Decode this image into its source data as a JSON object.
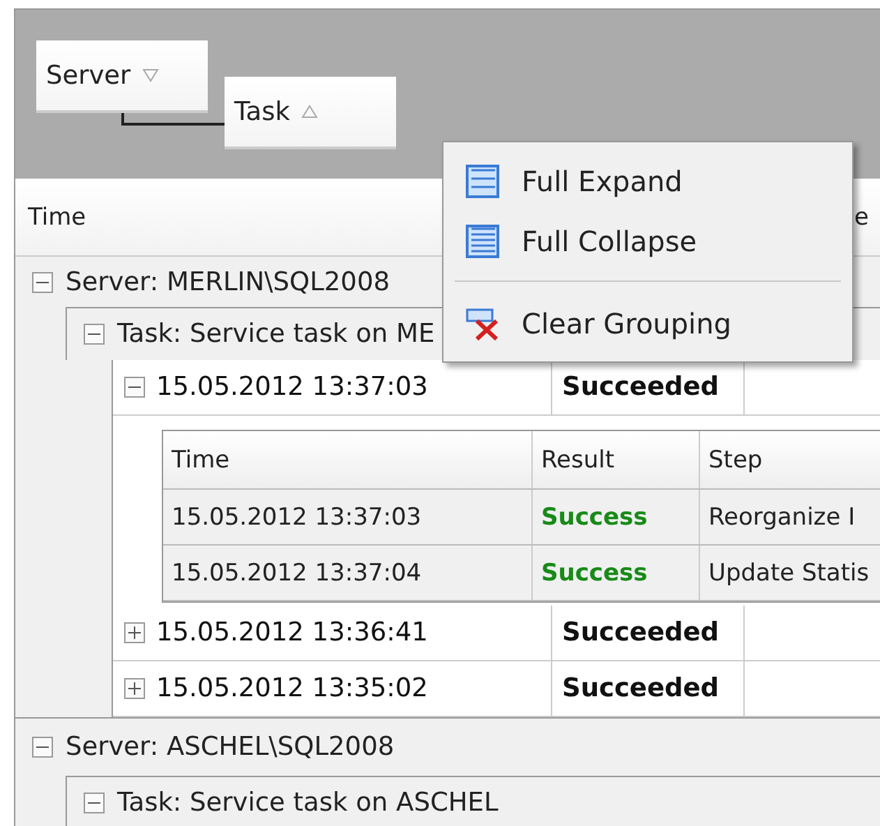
{
  "group_panel": {
    "chips": [
      {
        "label": "Server",
        "descending": true
      },
      {
        "label": "Task",
        "descending": false
      }
    ]
  },
  "columns": [
    {
      "label": "Time"
    },
    {
      "label": "e"
    }
  ],
  "groups": [
    {
      "label": "Server: MERLIN\\SQL2008",
      "expanded": true,
      "children": [
        {
          "label": "Task: Service task on ME",
          "expanded": true,
          "records": [
            {
              "time": "15.05.2012 13:37:03",
              "status": "Succeeded",
              "expanded": true,
              "detail": {
                "columns": [
                  "Time",
                  "Result",
                  "Step"
                ],
                "rows": [
                  {
                    "time": "15.05.2012 13:37:03",
                    "result": "Success",
                    "step": "Reorganize I"
                  },
                  {
                    "time": "15.05.2012 13:37:04",
                    "result": "Success",
                    "step": "Update Statis"
                  }
                ]
              }
            },
            {
              "time": "15.05.2012 13:36:41",
              "status": "Succeeded",
              "expanded": false
            },
            {
              "time": "15.05.2012 13:35:02",
              "status": "Succeeded",
              "expanded": false
            }
          ]
        }
      ]
    },
    {
      "label": "Server: ASCHEL\\SQL2008",
      "expanded": true,
      "children": [
        {
          "label": "Task: Service task on ASCHEL",
          "expanded": true
        }
      ]
    }
  ],
  "context_menu": {
    "items": [
      {
        "kind": "expand",
        "label": "Full Expand"
      },
      {
        "kind": "collapse",
        "label": "Full Collapse"
      },
      {
        "kind": "separator"
      },
      {
        "kind": "clear",
        "label": "Clear Grouping"
      }
    ]
  }
}
